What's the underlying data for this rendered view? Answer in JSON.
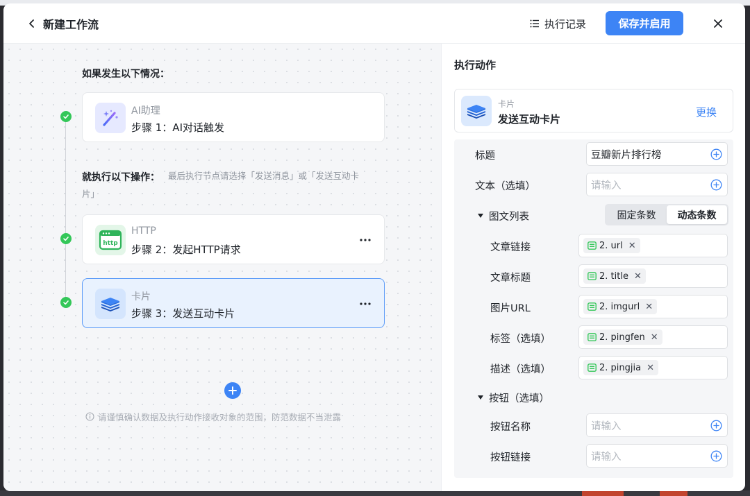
{
  "header": {
    "title": "新建工作流",
    "log_label": "执行记录",
    "save_label": "保存并启用"
  },
  "canvas": {
    "if_label": "如果发生以下情况：",
    "then_label": "就执行以下操作：",
    "then_hint_line1": "最后执行节点请选择「发送消息」或「发送互动卡",
    "then_hint_line2": "片」",
    "notice": "请谨慎确认数据及执行动作接收对象的范围，防范数据不当泄露",
    "nodes": [
      {
        "type": "AI助理",
        "title": "步骤 1：AI对话触发"
      },
      {
        "type": "HTTP",
        "title": "步骤 2：发起HTTP请求"
      },
      {
        "type": "卡片",
        "title": "步骤 3：发送互动卡片"
      }
    ]
  },
  "panel": {
    "title": "执行动作",
    "action_type": "卡片",
    "action_name": "发送互动卡片",
    "change_label": "更换",
    "title_label": "标题",
    "title_value": "豆瓣新片排行榜",
    "text_label": "文本（选填）",
    "text_placeholder": "请输入",
    "list_label": "图文列表",
    "toggle_fixed": "固定条数",
    "toggle_dynamic": "动态条数",
    "list_fields": [
      {
        "label": "文章链接",
        "tag": "2. url"
      },
      {
        "label": "文章标题",
        "tag": "2. title"
      },
      {
        "label": "图片URL",
        "tag": "2. imgurl"
      },
      {
        "label": "标签（选填）",
        "tag": "2. pingfen"
      },
      {
        "label": "描述（选填）",
        "tag": "2. pingjia"
      }
    ],
    "button_section_label": "按钮（选填）",
    "button_name_label": "按钮名称",
    "button_name_placeholder": "请输入",
    "button_link_label": "按钮链接",
    "button_link_placeholder": "请输入"
  },
  "colors": {
    "accent": "#3d84f5",
    "success": "#34c759",
    "active_node_bg": "#e9f2fe",
    "tag_icon": "#34c759"
  }
}
